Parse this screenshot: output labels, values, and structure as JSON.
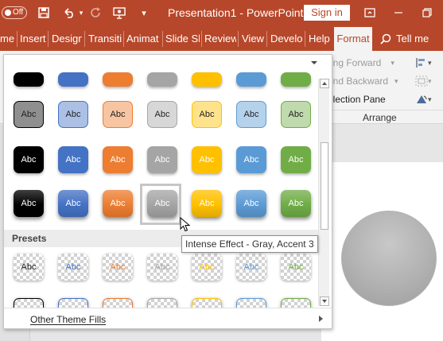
{
  "titlebar": {
    "autosave_label": "Off",
    "title": "Presentation1  -  PowerPoint",
    "signin_label": "Sign in",
    "qat_icons": [
      "save-icon",
      "undo-icon",
      "redo-icon",
      "present-icon",
      "customize-qat-icon"
    ]
  },
  "tabs": [
    "me",
    "Insert",
    "Design",
    "Transiti",
    "Animat",
    "Slide Sh",
    "Review",
    "View",
    "Develo",
    "Help",
    "Format"
  ],
  "tell_me": "Tell me",
  "ribbon": {
    "arrange_items": [
      "Bring Forward",
      "Send Backward",
      "Selection Pane"
    ],
    "group_label": "Arrange"
  },
  "gallery": {
    "swatch_text": "Abc",
    "theme_colors": [
      "#000000",
      "#4472C4",
      "#ED7D31",
      "#A5A5A5",
      "#FFC000",
      "#5B9BD5",
      "#70AD47"
    ],
    "presets_label": "Presets",
    "other_fills": "Other Theme Fills",
    "selected": "Intense Effect - Gray, Accent 3"
  },
  "tooltip": "Intense Effect - Gray, Accent 3",
  "colors": {
    "accent": "#B7472A"
  }
}
